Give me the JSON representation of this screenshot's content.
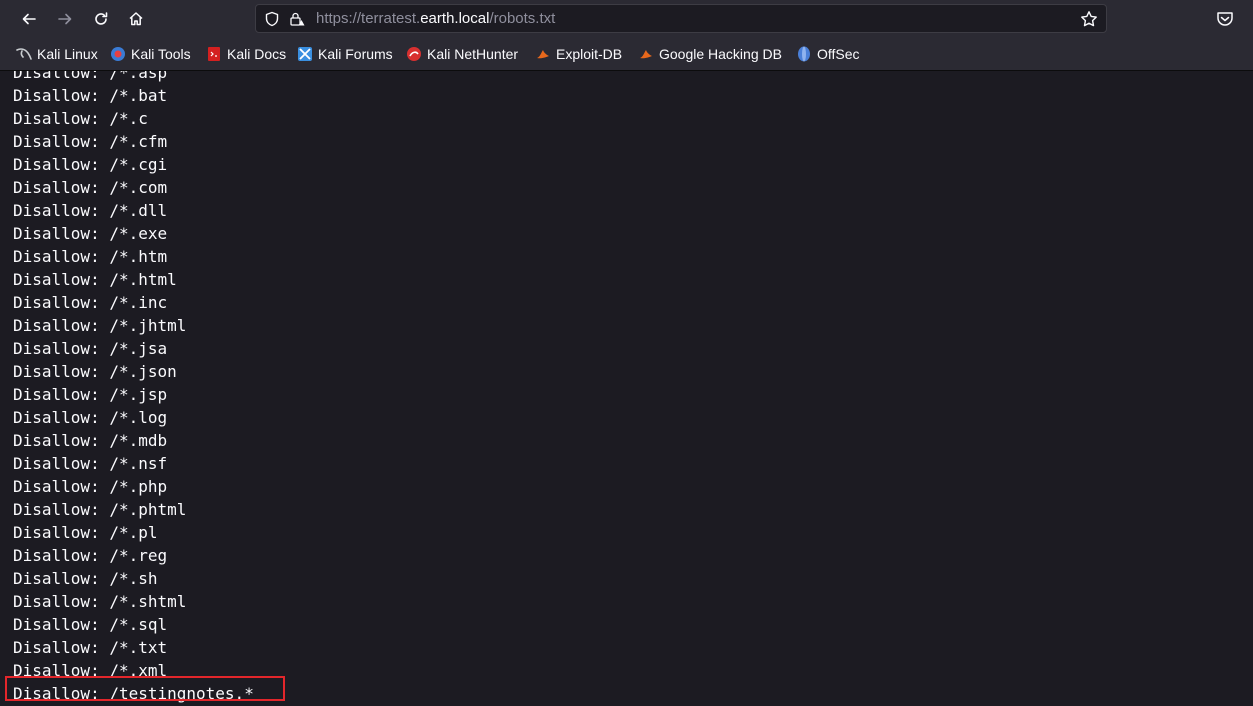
{
  "toolbar": {
    "back_icon": "back-arrow-icon",
    "forward_icon": "forward-arrow-icon",
    "reload_icon": "reload-icon",
    "home_icon": "home-icon",
    "url_prefix": "https://terratest.",
    "url_host": "earth.local",
    "url_path": "/robots.txt"
  },
  "bookmarks": [
    {
      "label": "Kali Linux",
      "icon": "kali-linux-icon",
      "color": "#9fa3a8"
    },
    {
      "label": "Kali Tools",
      "icon": "kali-tools-icon",
      "color": "#e84040"
    },
    {
      "label": "Kali Docs",
      "icon": "kali-docs-icon",
      "color": "#d42020"
    },
    {
      "label": "Kali Forums",
      "icon": "kali-forums-icon",
      "color": "#3a8fe0"
    },
    {
      "label": "Kali NetHunter",
      "icon": "kali-nethunter-icon",
      "color": "#d83030"
    },
    {
      "label": "Exploit-DB",
      "icon": "exploit-db-icon",
      "color": "#e8681c"
    },
    {
      "label": "Google Hacking DB",
      "icon": "google-hacking-db-icon",
      "color": "#e8681c"
    },
    {
      "label": "OffSec",
      "icon": "offsec-icon",
      "color": "#4a7fd8"
    }
  ],
  "robots": {
    "lines": [
      "Disallow: /*.asp",
      "Disallow: /*.bat",
      "Disallow: /*.c",
      "Disallow: /*.cfm",
      "Disallow: /*.cgi",
      "Disallow: /*.com",
      "Disallow: /*.dll",
      "Disallow: /*.exe",
      "Disallow: /*.htm",
      "Disallow: /*.html",
      "Disallow: /*.inc",
      "Disallow: /*.jhtml",
      "Disallow: /*.jsa",
      "Disallow: /*.json",
      "Disallow: /*.jsp",
      "Disallow: /*.log",
      "Disallow: /*.mdb",
      "Disallow: /*.nsf",
      "Disallow: /*.php",
      "Disallow: /*.phtml",
      "Disallow: /*.pl",
      "Disallow: /*.reg",
      "Disallow: /*.sh",
      "Disallow: /*.shtml",
      "Disallow: /*.sql",
      "Disallow: /*.txt",
      "Disallow: /*.xml",
      "Disallow: /testingnotes.*"
    ]
  },
  "colors": {
    "highlight": "#e3262b",
    "text": "#fbfbfe",
    "background": "#1c1b22"
  }
}
